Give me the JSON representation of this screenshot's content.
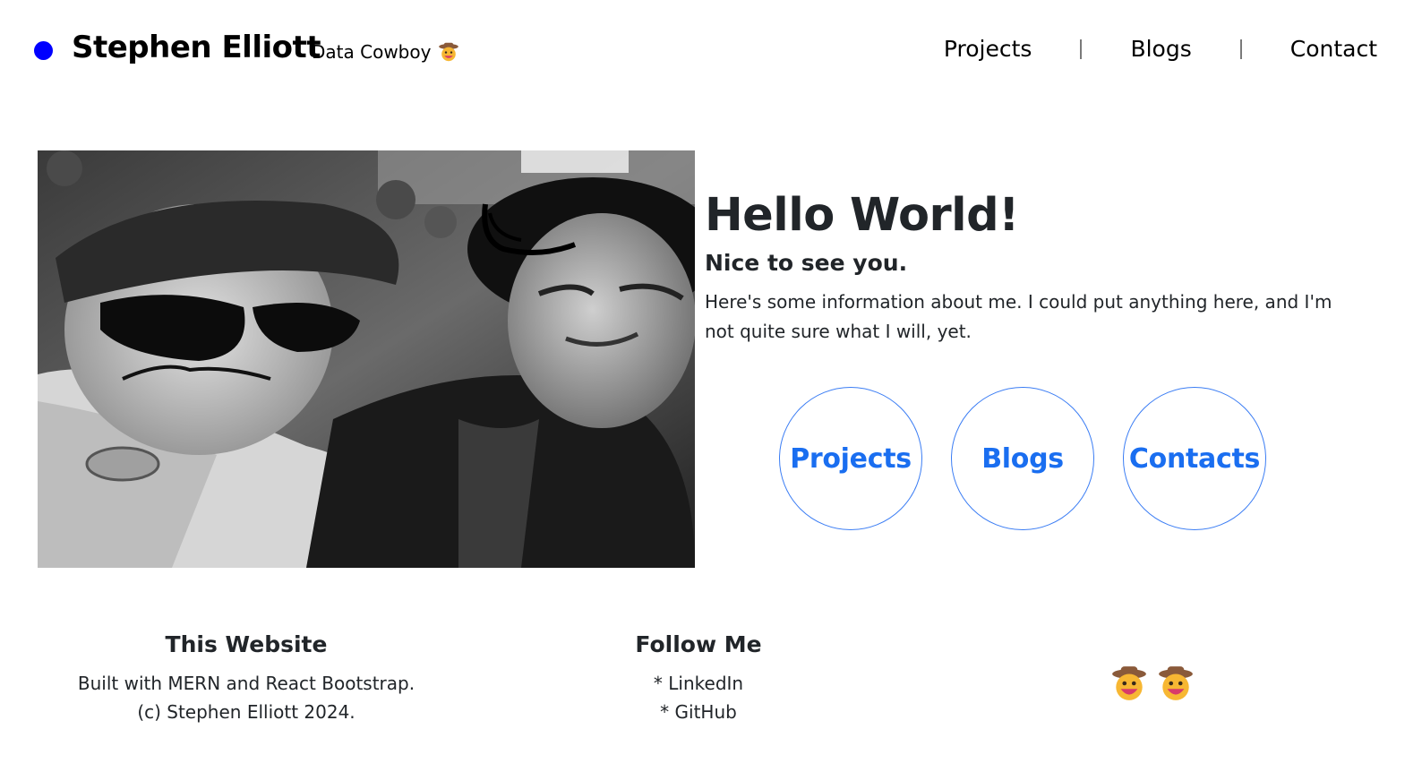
{
  "navbar": {
    "brand_name": "Stephen Elliott",
    "brand_tagline": "Data Cowboy",
    "links": [
      "Projects",
      "Blogs",
      "Contact"
    ]
  },
  "hero": {
    "title": "Hello World!",
    "subtitle": "Nice to see you.",
    "body": "Here's some information about me. I could put anything here, and I'm not quite sure what I will, yet.",
    "buttons": [
      "Projects",
      "Blogs",
      "Contacts"
    ]
  },
  "footer": {
    "site": {
      "heading": "This Website",
      "line1": "Built with MERN and React Bootstrap.",
      "line2": "(c) Stephen Elliott 2024."
    },
    "follow": {
      "heading": "Follow Me",
      "link1": "* LinkedIn",
      "link2": "* GitHub"
    },
    "emojis": [
      "cowboy-emoji-icon",
      "cowboy-emoji-icon"
    ]
  },
  "colors": {
    "brand_dot": "#0000ff",
    "accent": "#1a6ef0",
    "circle_border": "#3b7df4",
    "text": "#212529"
  }
}
